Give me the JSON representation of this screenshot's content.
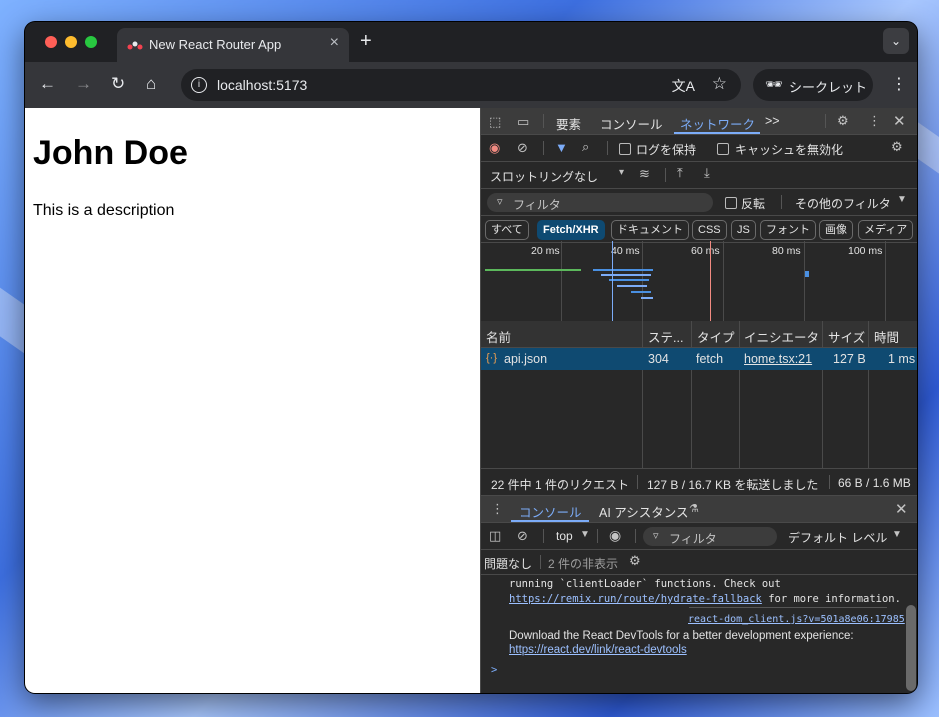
{
  "browser": {
    "tab_title": "New React Router App",
    "tab_close": "×",
    "new_tab": "+",
    "url": "localhost:5173",
    "incognito_label": "シークレット"
  },
  "page": {
    "heading": "John Doe",
    "description": "This is a description"
  },
  "devtools": {
    "tabs": [
      "要素",
      "コンソール",
      "ネットワーク"
    ],
    "more_tabs": ">>",
    "network": {
      "preserve_log": "ログを保持",
      "disable_cache": "キャッシュを無効化",
      "throttling": "スロットリングなし",
      "filter_placeholder": "フィルタ",
      "invert": "反転",
      "more_filters": "その他のフィルタ",
      "chips": [
        "すべて",
        "Fetch/XHR",
        "ドキュメント",
        "CSS",
        "JS",
        "フォント",
        "画像",
        "メディア"
      ],
      "timeline_labels": [
        "20 ms",
        "40 ms",
        "60 ms",
        "80 ms",
        "100 ms"
      ],
      "columns": [
        "名前",
        "ステ...",
        "タイプ",
        "イニシエータ",
        "サイズ",
        "時間"
      ],
      "rows": [
        {
          "name": "api.json",
          "status": "304",
          "type": "fetch",
          "initiator": "home.tsx:21",
          "size": "127 B",
          "time": "1 ms"
        }
      ],
      "summary": {
        "requests": "22 件中 1 件のリクエスト",
        "transferred": "127 B / 16.7 KB を転送しました",
        "resources": "66 B / 1.6 MB"
      }
    },
    "drawer": {
      "tabs": [
        "コンソール",
        "AI アシスタンス"
      ],
      "context": "top",
      "filter_placeholder": "フィルタ",
      "level": "デフォルト レベル",
      "no_issues": "問題なし",
      "hidden": "2 件の非表示"
    },
    "console": {
      "line1": "running `clientLoader` functions. Check out",
      "link1": "https://remix.run/route/hydrate-fallback",
      "line1_tail": " for more information.",
      "source": "react-dom_client.js?v=501a8e06:17985",
      "line2": "Download the React DevTools for a better development experience:",
      "link2": "https://react.dev/link/react-devtools",
      "prompt": ">"
    }
  }
}
